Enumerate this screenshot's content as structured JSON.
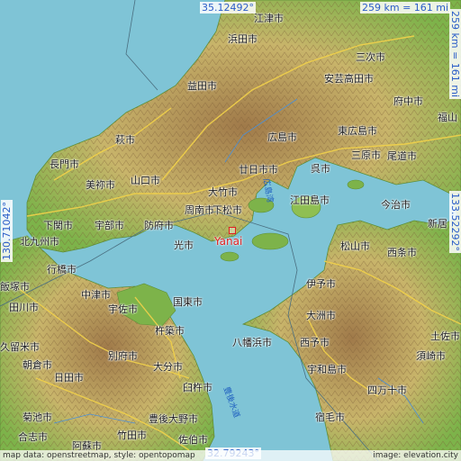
{
  "map": {
    "center_city": "Yanai",
    "colors": {
      "sea": "#7fc4d6",
      "land_low": "#6fae3e",
      "land_mid": "#c9b36a",
      "land_high": "#9a7b4f",
      "road": "#f2d24a",
      "marker": "#e02020",
      "coord_text": "#2a5cc8"
    }
  },
  "coords": {
    "top": "35.12492°",
    "bottom": "32.79243°",
    "left": "130.71042°",
    "right": "133.52292°",
    "scale_top": "259 km = 161 mi",
    "scale_right": "259 km = 161 mi"
  },
  "cities": [
    {
      "key": "nagato",
      "label": "長門市"
    },
    {
      "key": "hagi",
      "label": "萩市"
    },
    {
      "key": "mine",
      "label": "美祢市"
    },
    {
      "key": "yamaguchi",
      "label": "山口市"
    },
    {
      "key": "shimonoseki",
      "label": "下関市"
    },
    {
      "key": "ube",
      "label": "宇部市"
    },
    {
      "key": "kitakyushu",
      "label": "北九州市"
    },
    {
      "key": "yukuhashi",
      "label": "行橋市"
    },
    {
      "key": "hofu",
      "label": "防府市"
    },
    {
      "key": "shunan",
      "label": "周南市"
    },
    {
      "key": "kudamatsu",
      "label": "下松市"
    },
    {
      "key": "hikari",
      "label": "光市"
    },
    {
      "key": "iwakuni",
      "label": "大竹市"
    },
    {
      "key": "hatsukaichi",
      "label": "廿日市市"
    },
    {
      "key": "hiroshima",
      "label": "広島市"
    },
    {
      "key": "kure",
      "label": "呉市"
    },
    {
      "key": "etajima",
      "label": "江田島市"
    },
    {
      "key": "higashihiroshima",
      "label": "東広島市"
    },
    {
      "key": "mihara",
      "label": "三原市"
    },
    {
      "key": "onomichi",
      "label": "尾道市"
    },
    {
      "key": "fuchu",
      "label": "府中市"
    },
    {
      "key": "fukuyama",
      "label": "福山"
    },
    {
      "key": "miyoshi",
      "label": "三次市"
    },
    {
      "key": "akitakata",
      "label": "安芸高田市"
    },
    {
      "key": "hamada",
      "label": "浜田市"
    },
    {
      "key": "gotsu",
      "label": "江津市"
    },
    {
      "key": "masuda",
      "label": "益田市"
    },
    {
      "key": "imabari",
      "label": "今治市"
    },
    {
      "key": "niihama",
      "label": "新居"
    },
    {
      "key": "saijo",
      "label": "西条市"
    },
    {
      "key": "matsuyama",
      "label": "松山市"
    },
    {
      "key": "iyo",
      "label": "伊予市"
    },
    {
      "key": "ozu",
      "label": "大洲市"
    },
    {
      "key": "yawatahama",
      "label": "八幡浜市"
    },
    {
      "key": "seiyo",
      "label": "西予市"
    },
    {
      "key": "uwajima",
      "label": "宇和島市"
    },
    {
      "key": "shimanto",
      "label": "四万十市"
    },
    {
      "key": "sukumo",
      "label": "宿毛市"
    },
    {
      "key": "kami",
      "label": "土佐市"
    },
    {
      "key": "susaki",
      "label": "須崎市"
    },
    {
      "key": "nakatsu",
      "label": "中津市"
    },
    {
      "key": "usa",
      "label": "宇佐市"
    },
    {
      "key": "kunisaki",
      "label": "国東市"
    },
    {
      "key": "kitsuki",
      "label": "杵築市"
    },
    {
      "key": "beppu",
      "label": "別府市"
    },
    {
      "key": "oita",
      "label": "大分市"
    },
    {
      "key": "usuki",
      "label": "臼杵市"
    },
    {
      "key": "bungoono",
      "label": "豊後大野市"
    },
    {
      "key": "saiki",
      "label": "佐伯市"
    },
    {
      "key": "taketa",
      "label": "竹田市"
    },
    {
      "key": "hita",
      "label": "日田市"
    },
    {
      "key": "kurume",
      "label": "久留米市"
    },
    {
      "key": "asakura",
      "label": "朝倉市"
    },
    {
      "key": "tagawa",
      "label": "田川市"
    },
    {
      "key": "iizuka",
      "label": "飯塚市"
    },
    {
      "key": "kikuchi",
      "label": "菊池市"
    },
    {
      "key": "aso",
      "label": "阿蘇市"
    },
    {
      "key": "koshi",
      "label": "合志市"
    },
    {
      "key": "tsu",
      "label": "江津市"
    },
    {
      "key": "kozan",
      "label": "光市"
    }
  ],
  "water_labels": [
    {
      "key": "bungo-channel",
      "label": "豊後水道"
    },
    {
      "key": "inland-sea",
      "label": "広島湾"
    }
  ],
  "marker": {
    "label": "Yanai"
  },
  "attribution": {
    "left": "map data: openstreetmap, style: opentopomap",
    "right": "image: elevation.city"
  }
}
